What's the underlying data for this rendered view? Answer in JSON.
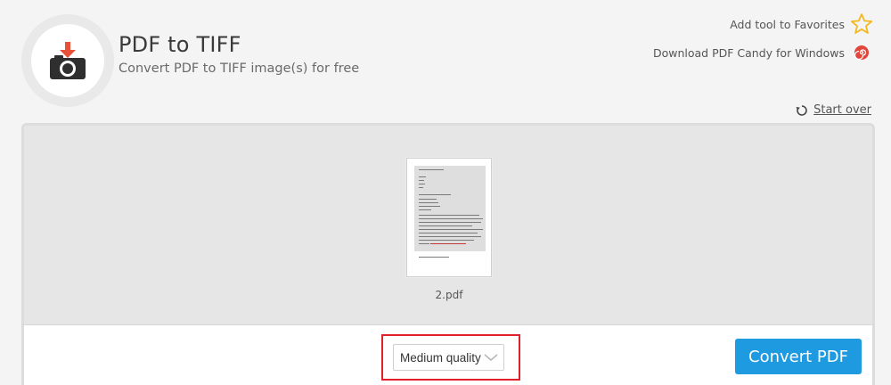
{
  "header": {
    "title": "PDF to TIFF",
    "subtitle": "Convert PDF to TIFF image(s) for free",
    "logo_icon": "camera-download-icon",
    "favorites_label": "Add tool to Favorites",
    "favorites_icon": "star-outline-icon",
    "download_label": "Download PDF Candy for Windows",
    "download_icon": "candy-swirl-icon"
  },
  "toolbar": {
    "start_over_label": "Start over",
    "start_over_icon": "refresh-icon"
  },
  "file": {
    "name": "2.pdf",
    "thumbnail_icon": "pdf-page-thumbnail"
  },
  "options": {
    "quality": {
      "selected": "Medium quality",
      "icon": "chevron-down-icon"
    },
    "convert_label": "Convert PDF"
  },
  "colors": {
    "accent": "#1e9ae0",
    "highlight": "#e0202a",
    "logo_arrow": "#e8503a",
    "star": "#f5b820",
    "candy": "#e0463a"
  }
}
